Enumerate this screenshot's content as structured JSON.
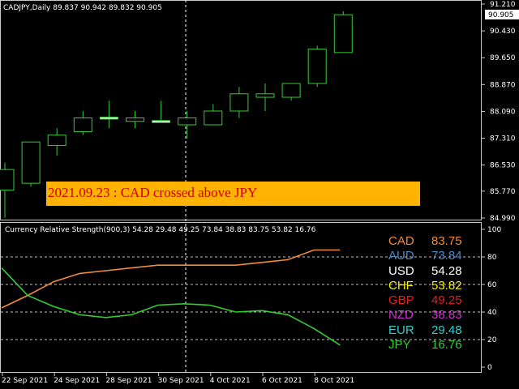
{
  "main_chart": {
    "header": "CADJPY,Daily  89.837 90.942 89.832 90.905",
    "current_price_label": "90.905",
    "price_ticks": [
      "91.210",
      "90.430",
      "89.650",
      "88.870",
      "88.090",
      "87.310",
      "86.530",
      "85.770",
      "84.990"
    ],
    "price_range": [
      84.99,
      91.21
    ],
    "candles": [
      {
        "o": 85.8,
        "h": 86.6,
        "l": 85.0,
        "c": 86.4,
        "bull": true
      },
      {
        "o": 86.0,
        "h": 87.2,
        "l": 85.9,
        "c": 87.2,
        "bull": true
      },
      {
        "o": 87.1,
        "h": 87.6,
        "l": 86.8,
        "c": 87.4,
        "bull": true
      },
      {
        "o": 87.5,
        "h": 88.1,
        "l": 87.4,
        "c": 87.9,
        "bull": true
      },
      {
        "o": 87.9,
        "h": 88.4,
        "l": 87.6,
        "c": 87.9,
        "bull": true
      },
      {
        "o": 87.9,
        "h": 88.1,
        "l": 87.6,
        "c": 87.8,
        "bull": true
      },
      {
        "o": 87.8,
        "h": 88.4,
        "l": 87.8,
        "c": 87.8,
        "bull": true
      },
      {
        "o": 87.7,
        "h": 88.1,
        "l": 87.3,
        "c": 87.9,
        "bull": true
      },
      {
        "o": 87.7,
        "h": 88.3,
        "l": 87.7,
        "c": 88.1,
        "bull": true
      },
      {
        "o": 88.1,
        "h": 88.8,
        "l": 87.9,
        "c": 88.6,
        "bull": true
      },
      {
        "o": 88.5,
        "h": 88.9,
        "l": 88.1,
        "c": 88.6,
        "bull": true
      },
      {
        "o": 88.5,
        "h": 88.9,
        "l": 88.4,
        "c": 88.9,
        "bull": true
      },
      {
        "o": 88.9,
        "h": 90.0,
        "l": 88.8,
        "c": 89.9,
        "bull": true
      },
      {
        "o": 89.8,
        "h": 91.0,
        "l": 89.8,
        "c": 90.9,
        "bull": true
      }
    ],
    "alert_text": "2021.09.23 : CAD crossed above JPY"
  },
  "indicator": {
    "header": "Currency Relative Strength(900,3) 54.28 29.48 49.25 73.84 38.83 83.75 53.82 16.76",
    "ticks": [
      "100",
      "80",
      "60",
      "40",
      "20",
      "0"
    ],
    "range": [
      0,
      100
    ],
    "dashed_levels": [
      20,
      40,
      60,
      80
    ],
    "x_points": [
      0,
      1,
      2,
      3,
      4,
      5,
      6,
      7,
      8,
      9,
      10,
      11,
      12,
      13
    ],
    "series": [
      {
        "color": "#f08c3c",
        "values": [
          43,
          52,
          62,
          68,
          70,
          72,
          74,
          74,
          74,
          74,
          76,
          78,
          85,
          85
        ]
      },
      {
        "color": "#33cc33",
        "values": [
          72,
          52,
          44,
          38,
          36,
          38,
          45,
          46,
          45,
          40,
          41,
          38,
          28,
          16
        ]
      }
    ],
    "legend": [
      {
        "currency": "CAD",
        "value": "83.75",
        "color": "#f08c3c"
      },
      {
        "currency": "AUD",
        "value": "73.84",
        "color": "#4a8cc8"
      },
      {
        "currency": "USD",
        "value": "54.28",
        "color": "#ffffff"
      },
      {
        "currency": "CHF",
        "value": "53.82",
        "color": "#f0f000"
      },
      {
        "currency": "GBP",
        "value": "49.25",
        "color": "#e02020"
      },
      {
        "currency": "NZD",
        "value": "38.83",
        "color": "#cc33cc"
      },
      {
        "currency": "EUR",
        "value": "29.48",
        "color": "#33cccc"
      },
      {
        "currency": "JPY",
        "value": "16.76",
        "color": "#33cc33"
      }
    ]
  },
  "time_axis": [
    "22 Sep 2021",
    "24 Sep 2021",
    "28 Sep 2021",
    "30 Sep 2021",
    "4 Oct 2021",
    "6 Oct 2021",
    "8 Oct 2021"
  ]
}
